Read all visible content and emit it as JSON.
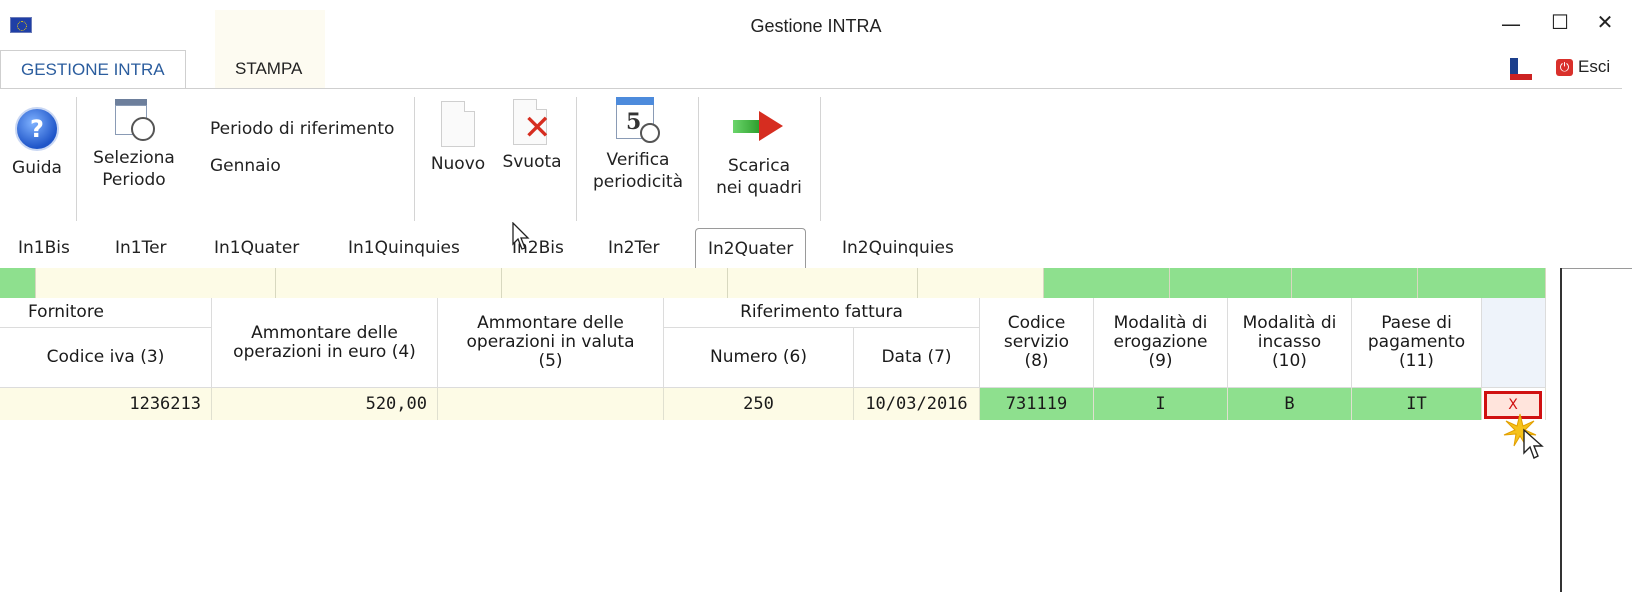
{
  "window": {
    "title": "Gestione INTRA",
    "minimize": "—",
    "maximize": "☐",
    "close": "✕"
  },
  "ribbon_tabs": [
    "GESTIONE INTRA",
    "STAMPA"
  ],
  "exit_label": "Esci",
  "ribbon": {
    "guida": "Guida",
    "seleziona_1": "Seleziona",
    "seleziona_2": "Periodo",
    "period_title": "Periodo di riferimento",
    "period_value": "Gennaio",
    "nuovo": "Nuovo",
    "svuota": "Svuota",
    "verifica_1": "Verifica",
    "verifica_2": "periodicità",
    "scarica_1": "Scarica",
    "scarica_2": "nei quadri",
    "calendar_day": "5"
  },
  "sub_tabs": [
    "In1Bis",
    "In1Ter",
    "In1Quater",
    "In1Quinquies",
    "In2Bis",
    "In2Ter",
    "In2Quater",
    "In2Quinquies"
  ],
  "active_sub_tab": "In2Quater",
  "grid": {
    "headers": {
      "fornitore": "Fornitore",
      "codice_iva": "Codice iva (3)",
      "ammontare_euro_1": "Ammontare delle",
      "ammontare_euro_2": "operazioni in euro (4)",
      "ammontare_valuta_1": "Ammontare delle",
      "ammontare_valuta_2": "operazioni in valuta",
      "ammontare_valuta_3": "(5)",
      "riferimento_fattura": "Riferimento fattura",
      "numero": "Numero (6)",
      "data": "Data (7)",
      "codice_servizio_1": "Codice",
      "codice_servizio_2": "servizio",
      "codice_servizio_3": "(8)",
      "modalita_erog_1": "Modalità di",
      "modalita_erog_2": "erogazione",
      "modalita_erog_3": "(9)",
      "modalita_incasso_1": "Modalità di",
      "modalita_incasso_2": "incasso",
      "modalita_incasso_3": "(10)",
      "paese_1": "Paese di",
      "paese_2": "pagamento",
      "paese_3": "(11)"
    },
    "rows": [
      {
        "codice_iva": "1236213",
        "ammontare_euro": "520,00",
        "ammontare_valuta": "",
        "numero": "250",
        "data": "10/03/2016",
        "codice_servizio": "731119",
        "modalita_erogazione": "I",
        "modalita_incasso": "B",
        "paese_pagamento": "IT",
        "delete": "X"
      }
    ]
  },
  "colors": {
    "accent_blue": "#2b5d9e",
    "cream": "#fdfbe6",
    "green": "#8ee08e",
    "delete_red": "#d01010"
  }
}
